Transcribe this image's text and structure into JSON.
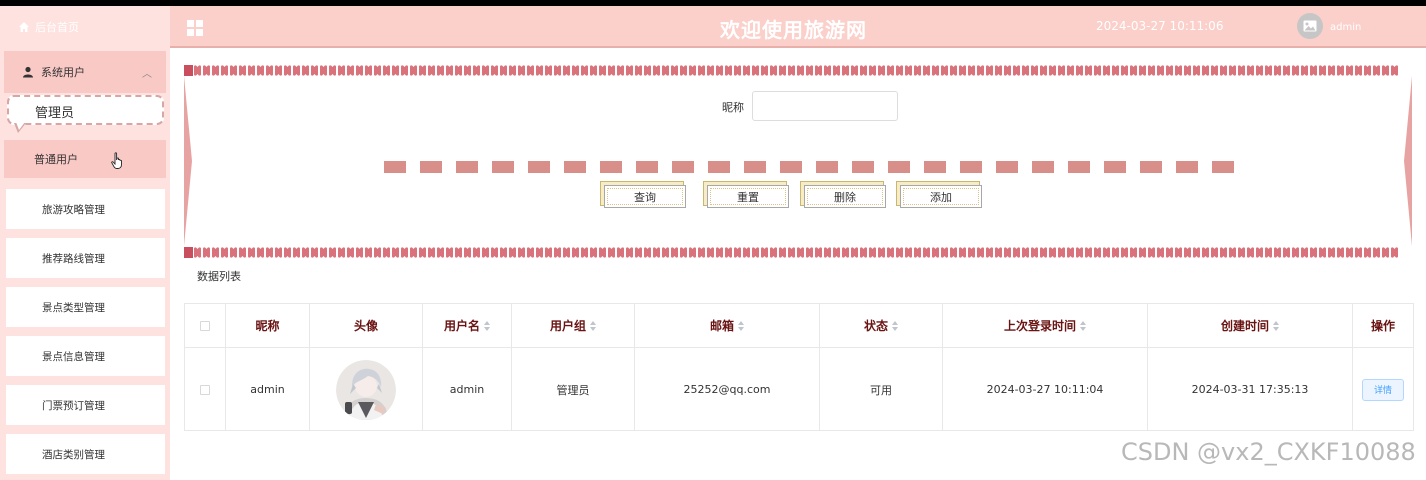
{
  "sidebar": {
    "home_label": "后台首页",
    "group_label": "系统用户",
    "items": [
      {
        "label": "管理员"
      },
      {
        "label": "普通用户"
      },
      {
        "label": "旅游攻略管理"
      },
      {
        "label": "推荐路线管理"
      },
      {
        "label": "景点类型管理"
      },
      {
        "label": "景点信息管理"
      },
      {
        "label": "门票预订管理"
      },
      {
        "label": "酒店类别管理"
      }
    ]
  },
  "header": {
    "title": "欢迎使用旅游网",
    "datetime": "2024-03-27 10:11:06",
    "username": "admin"
  },
  "search": {
    "nickname_label": "昵称",
    "nickname_value": "",
    "buttons": {
      "query": "查询",
      "reset": "重置",
      "delete": "删除",
      "add": "添加"
    }
  },
  "list": {
    "title": "数据列表",
    "columns": {
      "nickname": "昵称",
      "avatar": "头像",
      "username": "用户名",
      "group": "用户组",
      "email": "邮箱",
      "status": "状态",
      "last_login": "上次登录时间",
      "created": "创建时间",
      "action": "操作"
    },
    "rows": [
      {
        "nickname": "admin",
        "username": "admin",
        "group": "管理员",
        "email": "25252@qq.com",
        "status": "可用",
        "last_login": "2024-03-27 10:11:04",
        "created": "2024-03-31 17:35:13",
        "action": "详情"
      }
    ]
  },
  "watermark": "CSDN @vx2_CXKF10088",
  "colors": {
    "header_bg": "#fbcfca",
    "sidebar_bg": "#fde2df",
    "accent_dark": "#6a1313",
    "dash": "#d88f89"
  }
}
